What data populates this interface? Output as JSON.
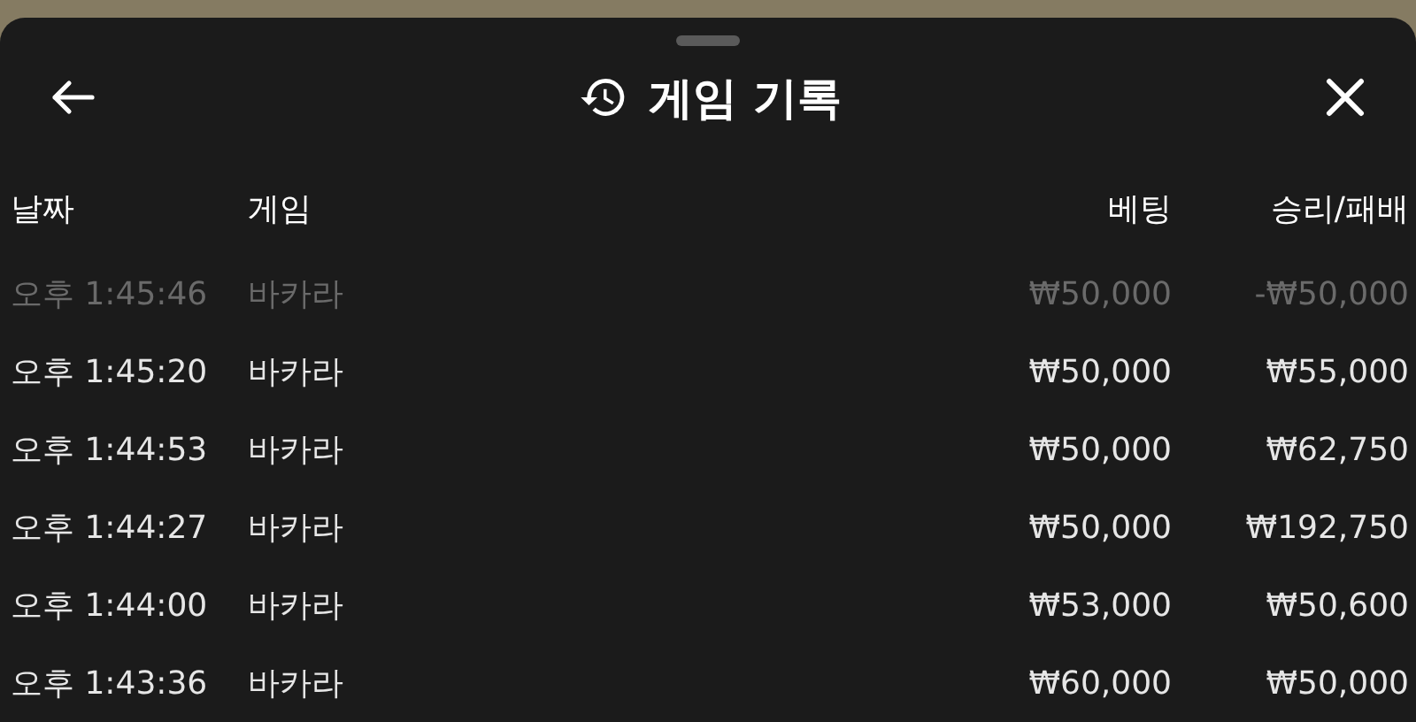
{
  "header": {
    "title": "게임 기록"
  },
  "table": {
    "columns": [
      "날짜",
      "게임",
      "베팅",
      "승리/패배"
    ],
    "rows": [
      {
        "date": "오후 1:45:46",
        "game": "바카라",
        "bet": "₩50,000",
        "result": "-₩50,000",
        "dimmed": true
      },
      {
        "date": "오후 1:45:20",
        "game": "바카라",
        "bet": "₩50,000",
        "result": "₩55,000",
        "dimmed": false
      },
      {
        "date": "오후 1:44:53",
        "game": "바카라",
        "bet": "₩50,000",
        "result": "₩62,750",
        "dimmed": false
      },
      {
        "date": "오후 1:44:27",
        "game": "바카라",
        "bet": "₩50,000",
        "result": "₩192,750",
        "dimmed": false
      },
      {
        "date": "오후 1:44:00",
        "game": "바카라",
        "bet": "₩53,000",
        "result": "₩50,600",
        "dimmed": false
      },
      {
        "date": "오후 1:43:36",
        "game": "바카라",
        "bet": "₩60,000",
        "result": "₩50,000",
        "dimmed": false
      }
    ]
  }
}
